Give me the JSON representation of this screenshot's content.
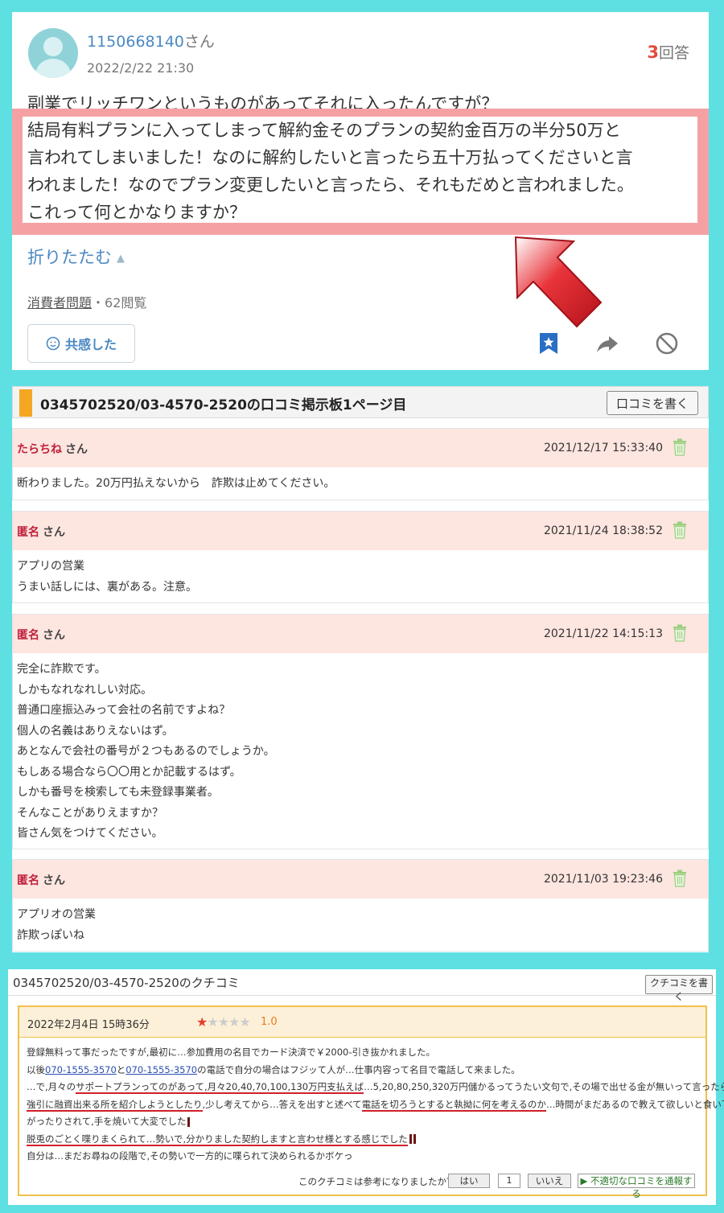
{
  "question": {
    "user_name": "1150668140",
    "user_suffix": "さん",
    "date": "2022/2/22 21:30",
    "answer_count": "3",
    "answer_label": "回答",
    "line1": "副業でリッチワンというものがあってそれに入ったんですが？",
    "highlight_lines": [
      "結局有料プランに入ってしまって解約金そのプランの契約金百万の半分50万と",
      "言われてしまいました！なのに解約したいと言ったら五十万払ってくださいと言",
      "われました！なのでプラン変更したいと言ったら、それもだめと言われました。",
      "これって何とかなりますか？"
    ],
    "fold_label": "折りたたむ",
    "category": "消費者問題",
    "views": "・62閲覧",
    "empathy_label": "共感した",
    "colors": {
      "accent": "#4a89c3",
      "highlight": "#f5a1a4",
      "arrow": "#d71920"
    }
  },
  "board": {
    "title": "0345702520/03-4570-2520の口コミ掲示板1ページ目",
    "write_label": "口コミを書く",
    "posts": [
      {
        "name": "たらちね",
        "suffix": "さん",
        "datetime": "2021/12/17 15:33:40",
        "lines": [
          "断わりました。20万円払えないから　詐欺は止めてください。"
        ]
      },
      {
        "name": "匿名",
        "suffix": "さん",
        "datetime": "2021/11/24 18:38:52",
        "lines": [
          "アプリの営業",
          "うまい話しには、裏がある。注意。"
        ]
      },
      {
        "name": "匿名",
        "suffix": "さん",
        "datetime": "2021/11/22 14:15:13",
        "lines": [
          "完全に詐欺です。",
          "しかもなれなれしい対応。",
          "普通口座振込みって会社の名前ですよね？",
          "個人の名義はありえないはず。",
          "あとなんで会社の番号が２つもあるのでしょうか。",
          "もしある場合なら〇〇用とか記載するはず。",
          "しかも番号を検索しても未登録事業者。",
          "そんなことがありえますか？",
          "皆さん気をつけてください。"
        ]
      },
      {
        "name": "匿名",
        "suffix": "さん",
        "datetime": "2021/11/03 19:23:46",
        "lines": [
          "アプリオの営業",
          "詐欺っぽいね"
        ]
      }
    ]
  },
  "kuchikomi": {
    "title": "0345702520/03-4570-2520のクチコミ",
    "write_label": "クチコミを書く",
    "date": "2022年2月4日 15時36分",
    "rating": 1,
    "rating_max": 5,
    "score": "1.0",
    "line1": "登録無料って事だったですが,最初に…参加費用の名目でカード決済で￥2000-引き抜かれました。",
    "line2_pre": "以後",
    "phone1": "070-1555-3570",
    "line2_mid": "と",
    "phone2": "070-1555-3570",
    "line2_post": "の電話で自分の場合はフジッて人が…仕事内容って名目で電話して来ました。",
    "line3_a": "…で,月々の",
    "line3_b": "サポートプランってのがあって,月々20,40,70,100,130万円支払えば",
    "line3_c": "…5,20,80,250,320万円儲かるってうたい文句で,その場で出せる金が無いって言ったら…半",
    "line4_a": "強引に融資出来る所を紹介しようとしたり",
    "line4_b": ",少し考えてから…答えを出すと述べて",
    "line4_c": "電話を切ろうとすると執拗に何を考えるのか",
    "line4_d": "…時間がまだあるので教えて欲しいと食い下",
    "line5": "がったりされて,手を焼いて大変でした",
    "line6": "脱兎のごとく喋りまくられて…勢いで,分かりました契約しますと言わせ様とする感じでした",
    "line7": "自分は…まだお尋ねの段階で,その勢いで一方的に喋られて決められるかボケっ",
    "helpful_q": "このクチコミは参考になりましたか？",
    "yes_label": "はい",
    "count": "1",
    "no_label": "いいえ",
    "report_label": "▶ 不適切な口コミを通報する"
  }
}
